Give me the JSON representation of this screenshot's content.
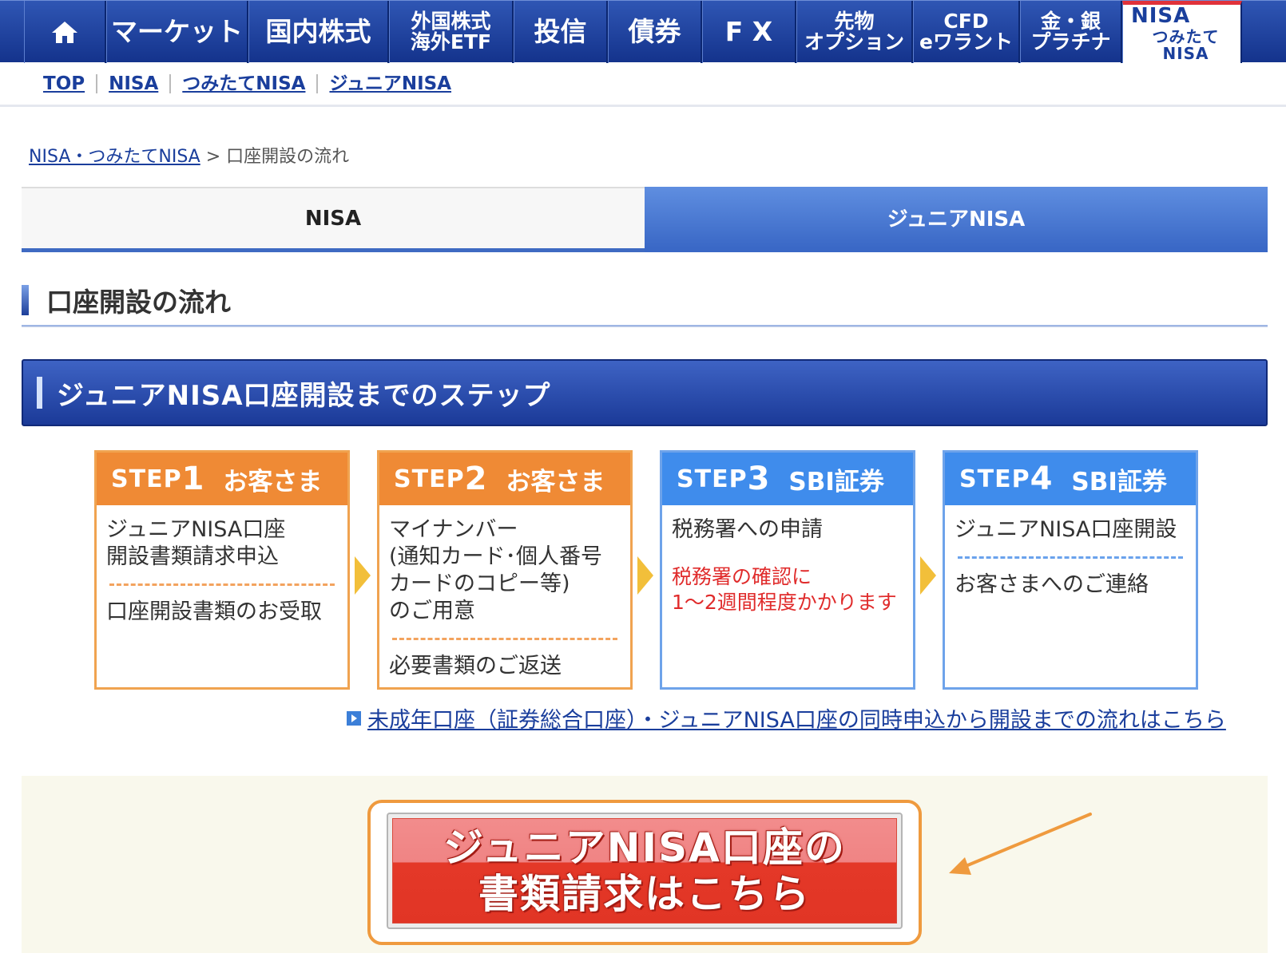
{
  "global_nav": {
    "items": [
      {
        "label": "マーケット"
      },
      {
        "label": "国内株式"
      },
      {
        "line1": "外国株式",
        "line2": "海外ETF"
      },
      {
        "label": "投信"
      },
      {
        "label": "債券"
      },
      {
        "label": "F X"
      },
      {
        "line1": "先物",
        "line2": "オプション"
      },
      {
        "line1": "CFD",
        "line2": "eワラント"
      },
      {
        "line1": "金・銀",
        "line2": "プラチナ"
      },
      {
        "line1": "NISA",
        "line2": "つみたてNISA"
      }
    ]
  },
  "sub_nav": [
    "TOP",
    "NISA",
    "つみたてNISA",
    "ジュニアNISA"
  ],
  "breadcrumb": {
    "link": "NISA・つみたてNISA",
    "current": "> 口座開設の流れ"
  },
  "tabs": [
    "NISA",
    "ジュニアNISA"
  ],
  "section_title": "口座開設の流れ",
  "steps_header": "ジュニアNISA口座開設までのステップ",
  "steps": [
    {
      "word": "STEP",
      "num": "1",
      "who": "お客さま",
      "lines_a": [
        "ジュニアNISA口座",
        "開設書類請求申込"
      ],
      "lines_b": [
        "口座開設書類のお受取"
      ]
    },
    {
      "word": "STEP",
      "num": "2",
      "who": "お客さま",
      "lines_a": [
        "マイナンバー",
        "(通知カード･個人番号",
        "カードのコピー等)",
        "のご用意"
      ],
      "lines_b": [
        "必要書類のご返送"
      ]
    },
    {
      "word": "STEP",
      "num": "3",
      "who": "SBI証券",
      "lines_a": [
        "税務署への申請"
      ],
      "notes": [
        "税務署の確認に",
        "1～2週間程度かかります"
      ]
    },
    {
      "word": "STEP",
      "num": "4",
      "who": "SBI証券",
      "lines_a": [
        "ジュニアNISA口座開設"
      ],
      "lines_b": [
        "お客さまへのご連絡"
      ]
    }
  ],
  "flow_link": "未成年口座（証券総合口座）・ジュニアNISA口座の同時申込から開設までの流れはこちら",
  "cta": {
    "line1": "ジュニアNISA口座の",
    "line2": "書類請求はこちら"
  },
  "colors": {
    "nav_blue": "#1b3a98",
    "step_orange": "#ef8a35",
    "step_blue": "#3f8cec",
    "cta_red": "#e13525",
    "note_red": "#e02b2b"
  }
}
